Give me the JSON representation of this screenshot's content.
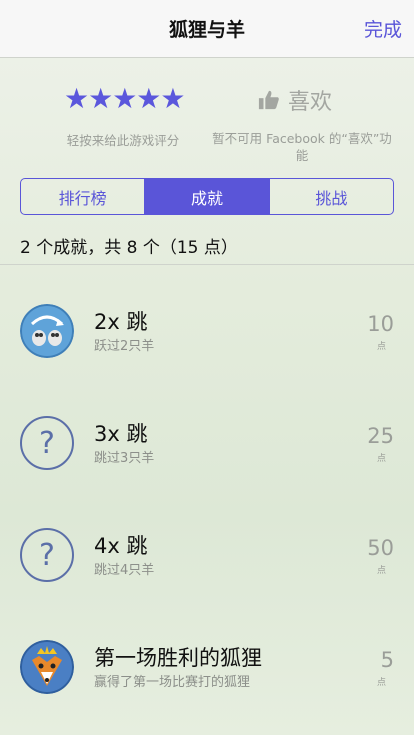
{
  "nav": {
    "title": "狐狸与羊",
    "done_label": "完成"
  },
  "rating": {
    "stars": "★★★★★",
    "rate_caption": "轻按来给此游戏评分",
    "like_label": "喜欢",
    "like_caption": "暂不可用 Facebook 的“喜欢”功能"
  },
  "tabs": [
    {
      "label": "排行榜",
      "active": false
    },
    {
      "label": "成就",
      "active": true
    },
    {
      "label": "挑战",
      "active": false
    }
  ],
  "summary": "2 个成就，共 8 个（15 点）",
  "achievements": [
    {
      "title": "2x 跳",
      "desc": "跃过2只羊",
      "points": "10",
      "unit": "点",
      "icon": "sheep-jump-icon"
    },
    {
      "title": "3x 跳",
      "desc": "跳过3只羊",
      "points": "25",
      "unit": "点",
      "icon": "question-icon"
    },
    {
      "title": "4x 跳",
      "desc": "跳过4只羊",
      "points": "50",
      "unit": "点",
      "icon": "question-icon"
    },
    {
      "title": "第一场胜利的狐狸",
      "desc": "赢得了第一场比赛打的狐狸",
      "points": "5",
      "unit": "点",
      "icon": "fox-crown-icon"
    }
  ],
  "colors": {
    "accent": "#5a55d8"
  }
}
